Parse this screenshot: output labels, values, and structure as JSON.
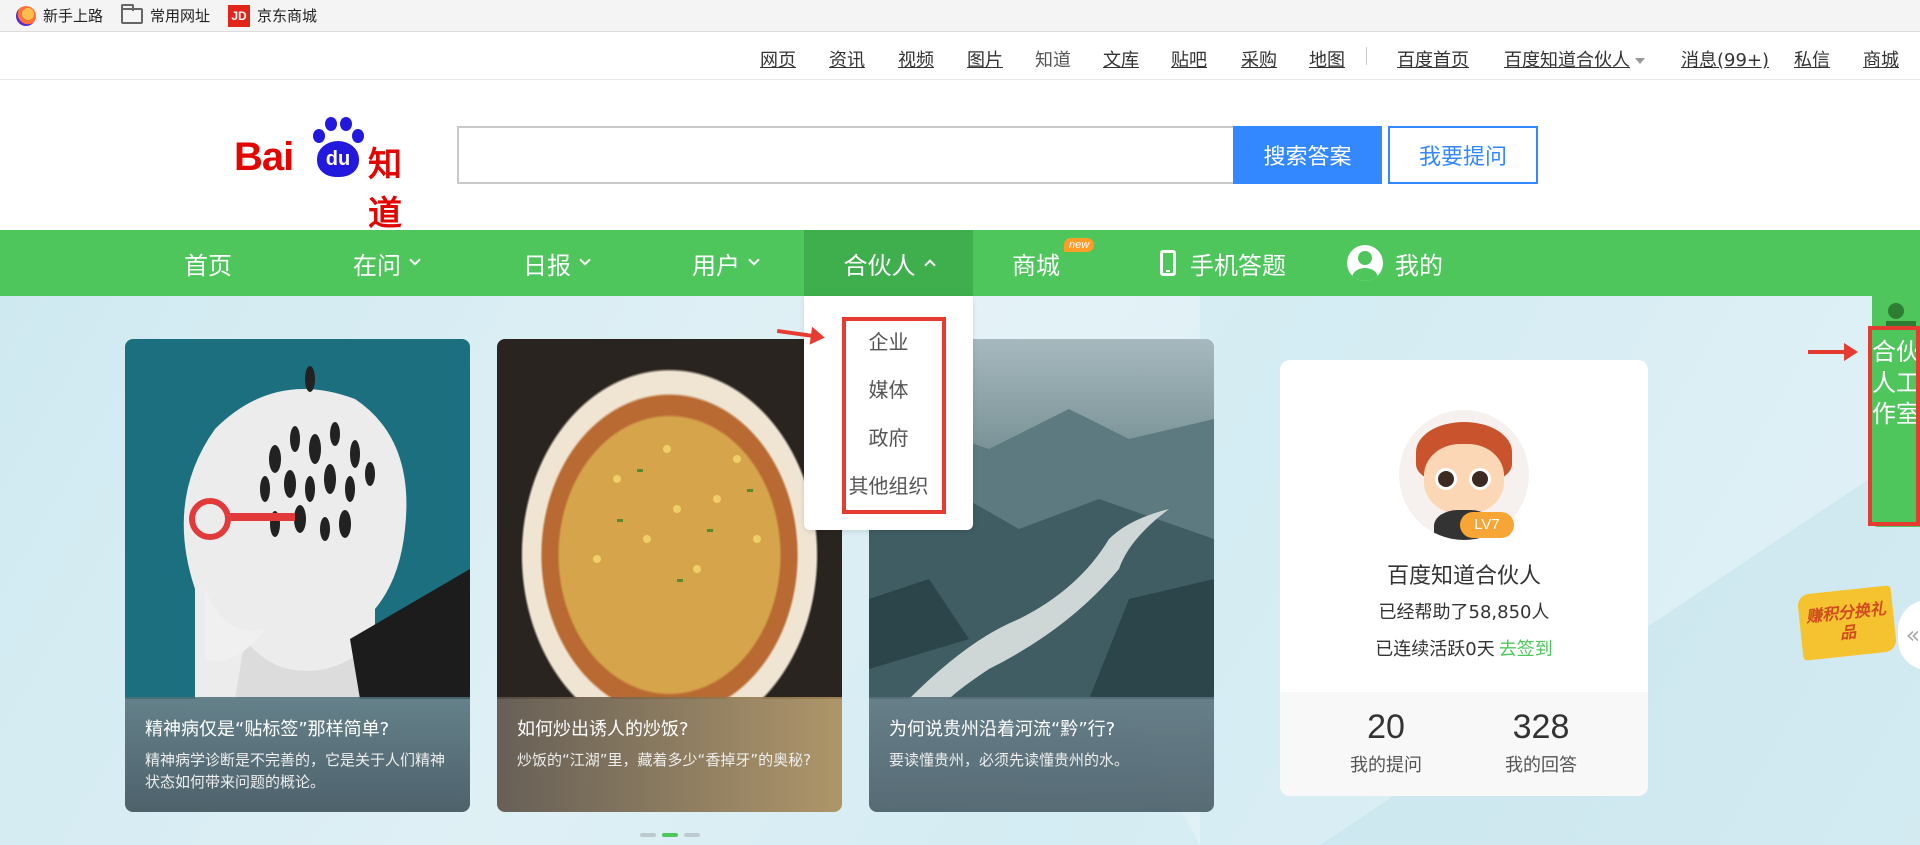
{
  "bookmarks": [
    {
      "label": "新手上路",
      "icon": "firefox-icon"
    },
    {
      "label": "常用网址",
      "icon": "folder-icon"
    },
    {
      "label": "京东商城",
      "icon": "jd-icon",
      "badge": "JD"
    }
  ],
  "topnav": {
    "links": [
      "网页",
      "资讯",
      "视频",
      "图片",
      "知道",
      "文库",
      "贴吧",
      "采购",
      "地图"
    ],
    "right": {
      "home": "百度首页",
      "partner": "百度知道合伙人",
      "messages": "消息(99+)",
      "dm": "私信",
      "mall": "商城"
    }
  },
  "logo": {
    "bai": "Bai",
    "du": "du",
    "zhidao": "知道"
  },
  "search": {
    "placeholder": "",
    "value": "",
    "search_label": "搜索答案",
    "ask_label": "我要提问"
  },
  "greennav": {
    "items": [
      "首页",
      "在问",
      "日报",
      "用户",
      "合伙人",
      "商城",
      "手机答题",
      "我的"
    ],
    "new_badge": "new"
  },
  "dropdown": {
    "items": [
      "企业",
      "媒体",
      "政府",
      "其他组织"
    ]
  },
  "cards": [
    {
      "title": "精神病仅是“贴标签”那样简单?",
      "desc": "精神病学诊断是不完善的，它是关于人们精神状态如何带来问题的概论。"
    },
    {
      "title": "如何炒出诱人的炒饭?",
      "desc": "炒饭的“江湖”里，藏着多少“香掉牙”的奥秘?"
    },
    {
      "title": "为何说贵州沿着河流“黔”行?",
      "desc": "要读懂贵州，必须先读懂贵州的水。"
    }
  ],
  "profile": {
    "level": "LV7",
    "name": "百度知道合伙人",
    "helped": "已经帮助了58,850人",
    "active": "已连续活跃0天",
    "checkin": "去签到",
    "questions": {
      "count": "20",
      "label": "我的提问"
    },
    "answers": {
      "count": "328",
      "label": "我的回答"
    }
  },
  "partner_tab": "合伙人工作室",
  "gift": "赚积分换礼品",
  "colors": {
    "green": "#4ec65c",
    "blue": "#3388ff",
    "red": "#e10602",
    "annotation": "#e53b30"
  }
}
